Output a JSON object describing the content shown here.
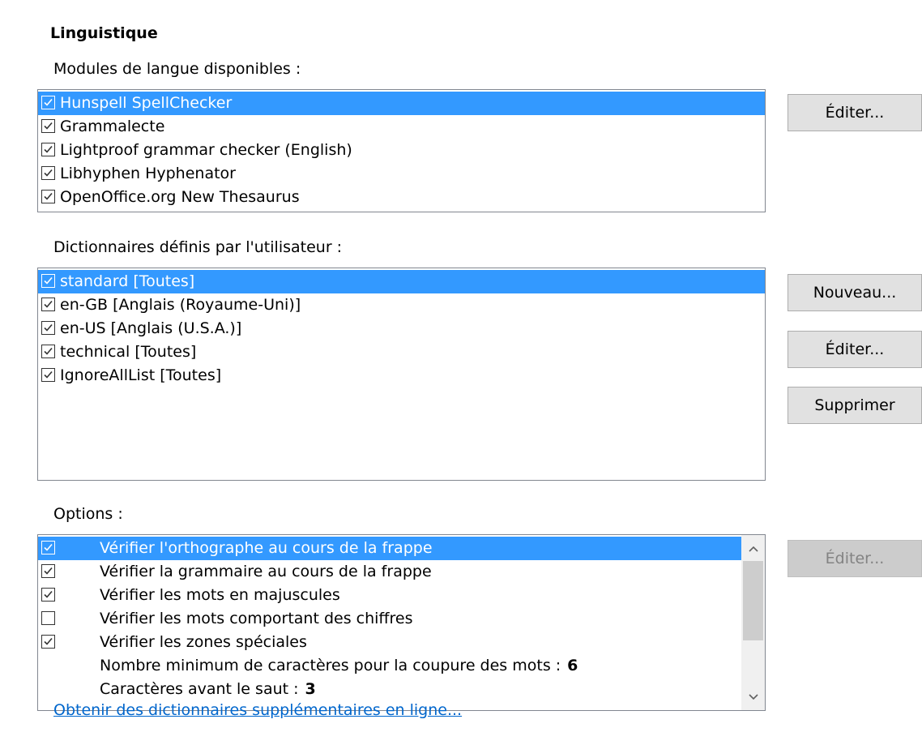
{
  "section_title": "Linguistique",
  "modules": {
    "label": "Modules de langue disponibles :",
    "items": [
      {
        "label": "Hunspell SpellChecker",
        "checked": true,
        "selected": true
      },
      {
        "label": "Grammalecte",
        "checked": true,
        "selected": false
      },
      {
        "label": "Lightproof grammar checker (English)",
        "checked": true,
        "selected": false
      },
      {
        "label": "Libhyphen Hyphenator",
        "checked": true,
        "selected": false
      },
      {
        "label": "OpenOffice.org New Thesaurus",
        "checked": true,
        "selected": false
      }
    ],
    "edit_button": "Éditer..."
  },
  "dictionaries": {
    "label": "Dictionnaires définis par l'utilisateur :",
    "items": [
      {
        "label": "standard [Toutes]",
        "checked": true,
        "selected": true
      },
      {
        "label": "en-GB [Anglais (Royaume-Uni)]",
        "checked": true,
        "selected": false
      },
      {
        "label": "en-US [Anglais (U.S.A.)]",
        "checked": true,
        "selected": false
      },
      {
        "label": "technical [Toutes]",
        "checked": true,
        "selected": false
      },
      {
        "label": "IgnoreAllList [Toutes]",
        "checked": true,
        "selected": false
      }
    ],
    "new_button": "Nouveau...",
    "edit_button": "Éditer...",
    "delete_button": "Supprimer"
  },
  "options": {
    "label": "Options :",
    "items": [
      {
        "label": "Vérifier l'orthographe au cours de la frappe",
        "checked": true,
        "selected": true
      },
      {
        "label": "Vérifier la grammaire au cours de la frappe",
        "checked": true,
        "selected": false
      },
      {
        "label": "Vérifier les mots en majuscules",
        "checked": true,
        "selected": false
      },
      {
        "label": "Vérifier les mots comportant des chiffres",
        "checked": false,
        "selected": false
      },
      {
        "label": "Vérifier les zones spéciales",
        "checked": true,
        "selected": false
      },
      {
        "label": "Nombre minimum de caractères pour la coupure des mots :",
        "value": "6"
      },
      {
        "label": "Caractères avant le saut :",
        "value": "3"
      }
    ],
    "edit_button": "Éditer..."
  },
  "online_link": "Obtenir des dictionnaires supplémentaires en ligne...",
  "colors": {
    "selection": "#3399ff",
    "link": "#0066cc",
    "button_bg": "#e1e1e1"
  },
  "icons": {
    "checkbox": "check-icon",
    "scroll_up": "chevron-up-icon",
    "scroll_down": "chevron-down-icon"
  }
}
